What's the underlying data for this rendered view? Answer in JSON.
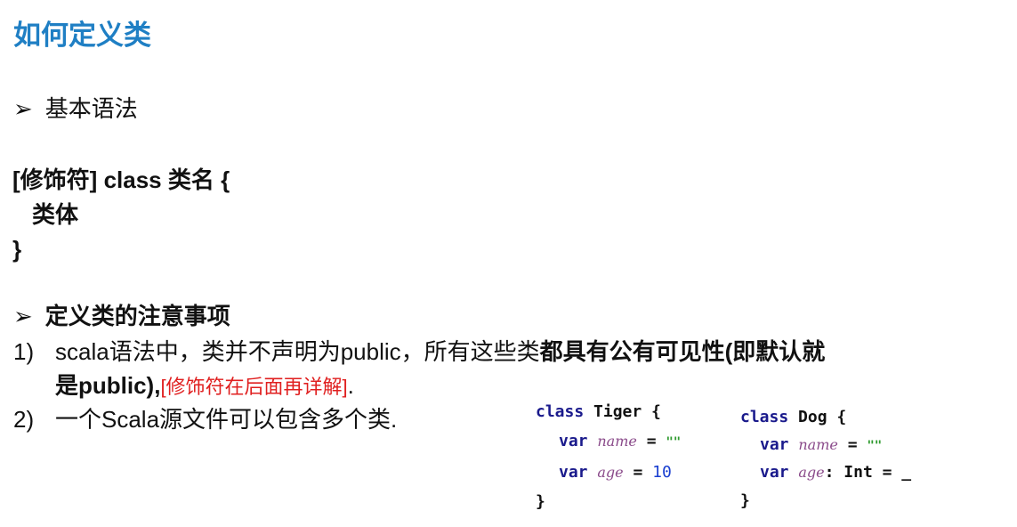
{
  "title": "如何定义类",
  "section1": {
    "bullet": "➢",
    "label": "基本语法"
  },
  "syntax": {
    "line1_mod": "[修饰符]",
    "line1_kw": "class",
    "line1_rest": "类名 {",
    "line2": "类体",
    "line3": "}"
  },
  "section2": {
    "bullet": "➢",
    "label": "定义类的注意事项"
  },
  "items": [
    {
      "num": "1)",
      "text_normal": "scala语法中，类并不声明为public，所有这些类",
      "text_bold": "都具有公有可见性(即默认就",
      "cont_bold": "是public),",
      "cont_red": "[修饰符在后面再详解]",
      "cont_end": "."
    },
    {
      "num": "2)",
      "text": "一个Scala源文件可以包含多个类."
    }
  ],
  "code": {
    "tiger": {
      "l1_kw": "class",
      "l1_rest": "Tiger {",
      "var": "var",
      "name": "name",
      "eq": "=",
      "str": "\"\"",
      "age": "age",
      "ageval": "10",
      "close": "}"
    },
    "dog": {
      "l1_kw": "class",
      "l1_rest": "Dog {",
      "var": "var",
      "name": "name",
      "eq": "=",
      "str": "\"\"",
      "age": "age",
      "agetype": ": Int = _",
      "close": "}"
    }
  }
}
